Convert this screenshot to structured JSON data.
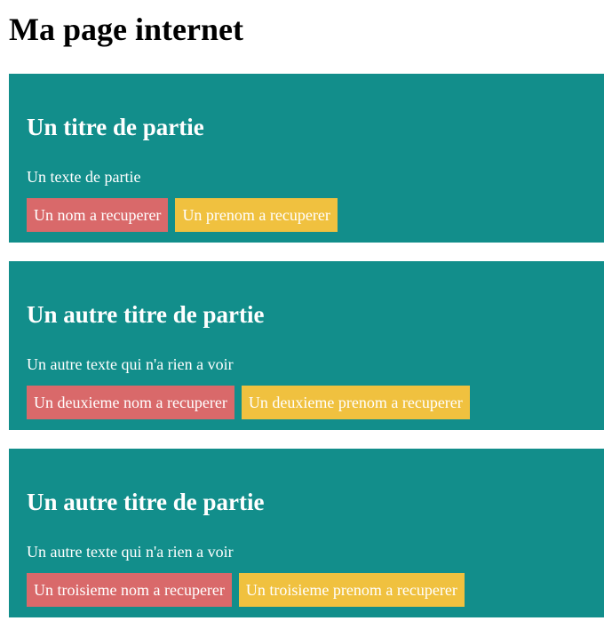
{
  "page": {
    "title": "Ma page internet"
  },
  "colors": {
    "section_bg": "#128e8b",
    "nom_bg": "#d9696a",
    "prenom_bg": "#f0c13f"
  },
  "sections": [
    {
      "title": "Un titre de partie",
      "text": "Un texte de partie",
      "nom": "Un nom a recuperer",
      "prenom": "Un prenom a recuperer"
    },
    {
      "title": "Un autre titre de partie",
      "text": "Un autre texte qui n'a rien a voir",
      "nom": "Un deuxieme nom a recuperer",
      "prenom": "Un deuxieme prenom a recuperer"
    },
    {
      "title": "Un autre titre de partie",
      "text": "Un autre texte qui n'a rien a voir",
      "nom": "Un troisieme nom a recuperer",
      "prenom": "Un troisieme prenom a recuperer"
    }
  ]
}
